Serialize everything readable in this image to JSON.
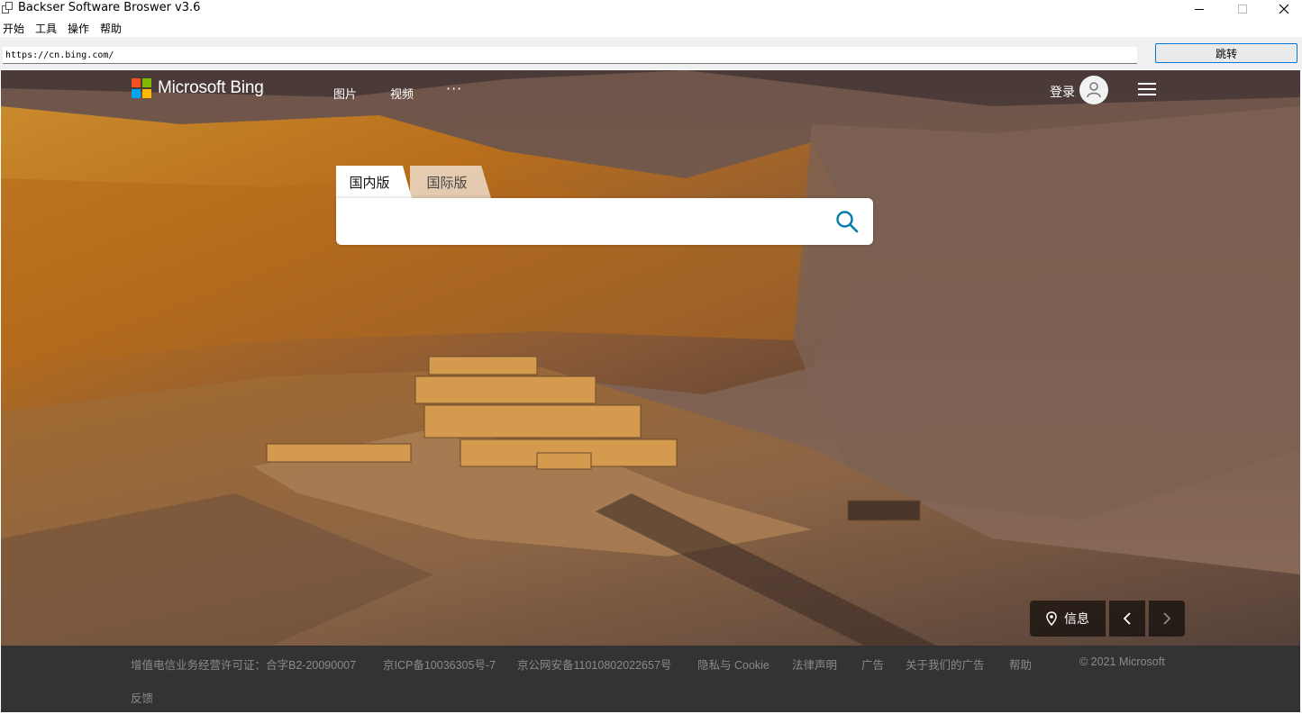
{
  "window": {
    "title": "Backser Software Broswer v3.6"
  },
  "menu": {
    "items": [
      "开始",
      "工具",
      "操作",
      "帮助"
    ]
  },
  "address": {
    "url": "https://cn.bing.com/",
    "go_label": "跳转"
  },
  "bing": {
    "logo_text": "Microsoft Bing",
    "nav": {
      "images": "图片",
      "videos": "视频",
      "more": "···"
    },
    "login_label": "登录",
    "tabs": {
      "domestic": "国内版",
      "international": "国际版"
    },
    "search": {
      "value": "",
      "placeholder": ""
    },
    "hero": {
      "info_label": "信息"
    },
    "footer": {
      "links": [
        "增值电信业务经营许可证：合字B2-20090007",
        "京ICP备10036305号-7",
        "京公网安备11010802022657号",
        "隐私与 Cookie",
        "法律声明",
        "广告",
        "关于我们的广告",
        "帮助"
      ],
      "copyright": "© 2021 Microsoft",
      "feedback": "反馈"
    }
  },
  "colors": {
    "accent_blue": "#0078d7",
    "search_icon": "#007daa",
    "footer_bg": "#333333",
    "footer_text": "#8a8a8a"
  }
}
